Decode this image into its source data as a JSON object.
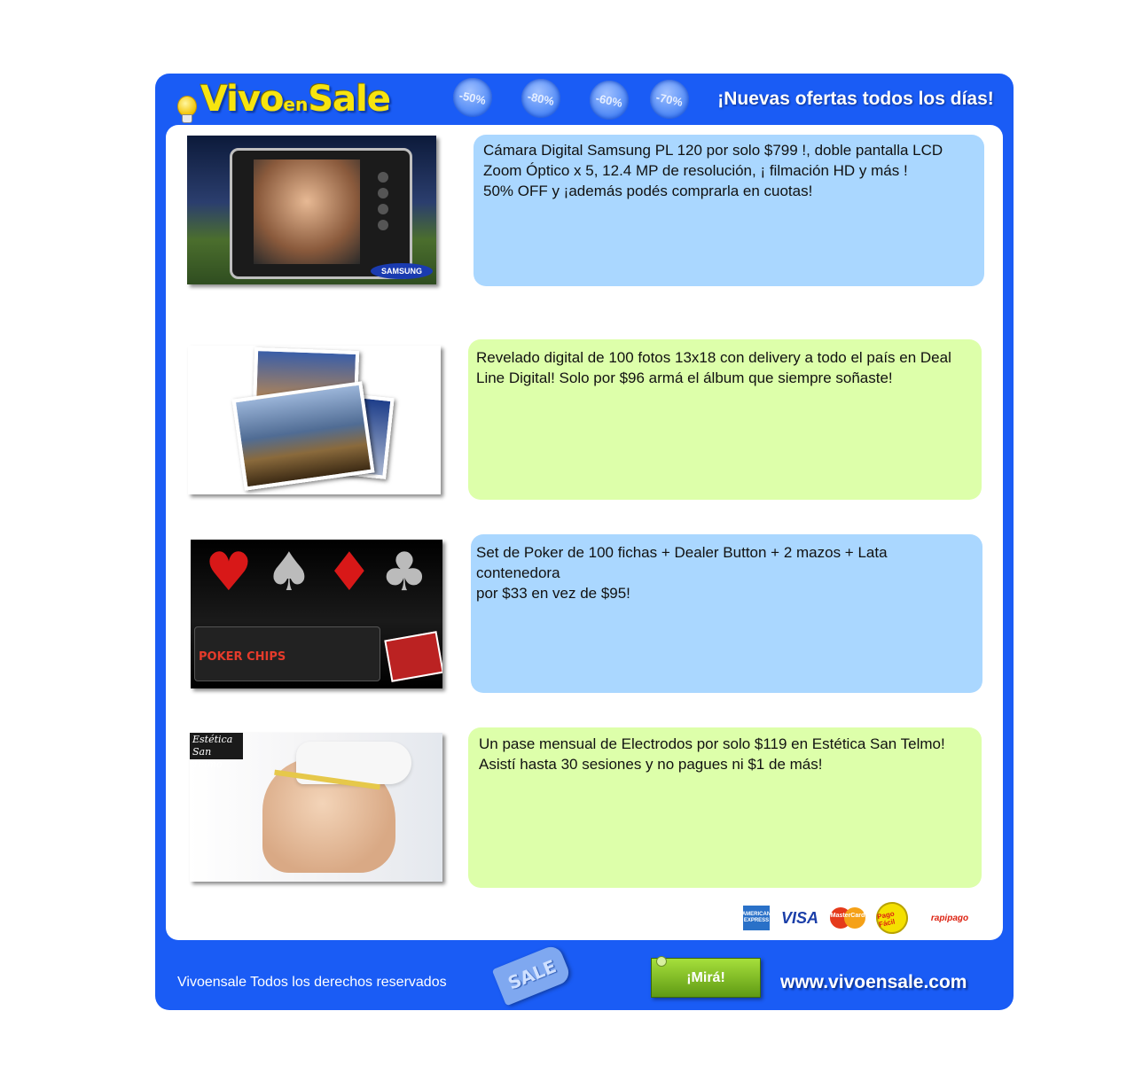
{
  "header": {
    "logo_main": "Vivo",
    "logo_en": "en",
    "logo_sale": "Sale",
    "badges": [
      "-50%",
      "-80%",
      "-60%",
      "-70%"
    ],
    "tagline": "¡Nuevas ofertas todos los días!"
  },
  "deals": [
    {
      "lines": [
        "Cámara Digital Samsung PL 120 por solo $799 !, doble pantalla LCD",
        "Zoom Óptico x 5, 12.4 MP de resolución, ¡ filmación HD y más !",
        "50% OFF y ¡además podés comprarla en cuotas!"
      ],
      "image_label": "SAMSUNG",
      "color": "#aad7ff"
    },
    {
      "lines": [
        "Revelado digital de 100 fotos 13x18 con delivery a todo el país en Deal",
        "Line Digital! Solo por $96 armá el álbum que siempre soñaste!"
      ],
      "color": "#ddffaa"
    },
    {
      "lines": [
        "Set de Poker de 100 fichas + Dealer Button + 2 mazos + Lata contenedora",
        "por $33 en vez de $95!"
      ],
      "image_label": "POKER CHIPS",
      "color": "#aad7ff"
    },
    {
      "lines": [
        "Un pase mensual de Electrodos por solo $119 en Estética San Telmo!",
        "Asistí hasta 30 sesiones y no pagues ni $1 de más!"
      ],
      "image_label_1": "Estética",
      "image_label_2": "San Telmo",
      "color": "#ddffaa"
    }
  ],
  "payments": {
    "amex": "AMERICAN EXPRESS",
    "visa": "VISA",
    "mastercard": "MasterCard",
    "pagofacil": "Pago Fácil",
    "rapipago": "rapipago"
  },
  "footer": {
    "copyright": "Vivoensale Todos los derechos reservados",
    "sale_tag": "SALE",
    "mira_button": "¡Mirá!",
    "url": "www.vivoensale.com"
  },
  "colors": {
    "frame": "#1a5cf5",
    "blue_box": "#aad7ff",
    "green_box": "#ddffaa",
    "button": "#7fbf22"
  }
}
